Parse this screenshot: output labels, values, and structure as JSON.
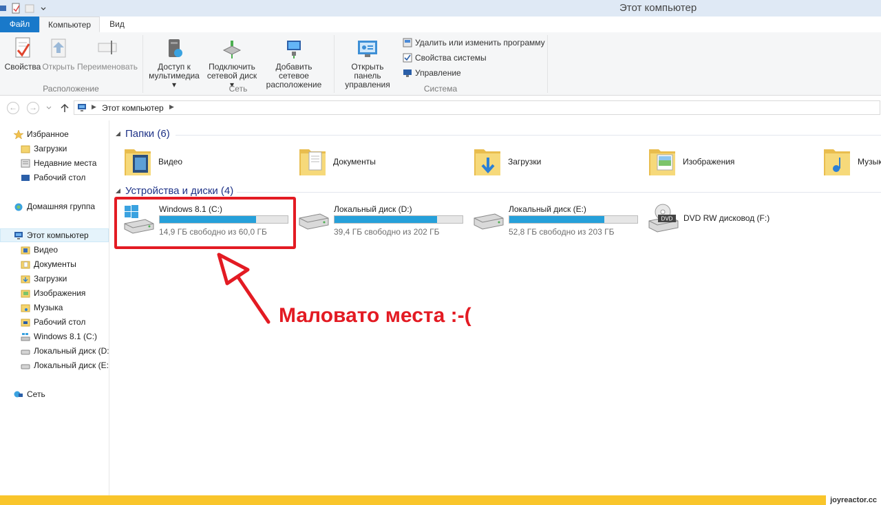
{
  "window": {
    "title": "Этот компьютер"
  },
  "tabs": {
    "file": "Файл",
    "computer": "Компьютер",
    "view": "Вид"
  },
  "ribbon": {
    "location": {
      "label": "Расположение",
      "properties": "Свойства",
      "open": "Открыть",
      "rename": "Переименовать"
    },
    "network": {
      "label": "Сеть",
      "media_line1": "Доступ к",
      "media_line2": "мультимедиа",
      "map_line1": "Подключить",
      "map_line2": "сетевой диск",
      "add_line1": "Добавить сетевое",
      "add_line2": "расположение"
    },
    "system": {
      "label": "Система",
      "cp_line1": "Открыть панель",
      "cp_line2": "управления",
      "uninstall": "Удалить или изменить программу",
      "sysprops": "Свойства системы",
      "manage": "Управление"
    }
  },
  "address": {
    "path": "Этот компьютер"
  },
  "nav": {
    "favorites": "Избранное",
    "downloads": "Загрузки",
    "recent": "Недавние места",
    "desktop": "Рабочий стол",
    "homegroup": "Домашняя группа",
    "this_pc": "Этот компьютер",
    "pc_video": "Видео",
    "pc_documents": "Документы",
    "pc_downloads": "Загрузки",
    "pc_pictures": "Изображения",
    "pc_music": "Музыка",
    "pc_desktop": "Рабочий стол",
    "drive_c": "Windows 8.1 (C:)",
    "drive_d": "Локальный диск (D:)",
    "drive_e": "Локальный диск (E:)",
    "network": "Сеть"
  },
  "folders": {
    "header": "Папки (6)",
    "items": [
      "Видео",
      "Документы",
      "Загрузки",
      "Изображения",
      "Музыка"
    ]
  },
  "drives": {
    "header": "Устройства и диски (4)",
    "c": {
      "name": "Windows 8.1 (C:)",
      "free": "14,9 ГБ свободно из 60,0 ГБ",
      "used_fraction": 0.75
    },
    "d": {
      "name": "Локальный диск (D:)",
      "free": "39,4 ГБ свободно из 202 ГБ",
      "used_fraction": 0.8
    },
    "e": {
      "name": "Локальный диск (E:)",
      "free": "52,8 ГБ свободно из 203 ГБ",
      "used_fraction": 0.74
    },
    "f": {
      "name": "DVD RW дисковод (F:)",
      "badge": "DVD"
    }
  },
  "annotation": {
    "text": "Маловато места :-("
  },
  "watermark": "joyreactor.cc",
  "colors": {
    "accent": "#1979ca",
    "bar_fill": "#26a0da",
    "annotation": "#e31b23",
    "group_header": "#1e3287"
  }
}
